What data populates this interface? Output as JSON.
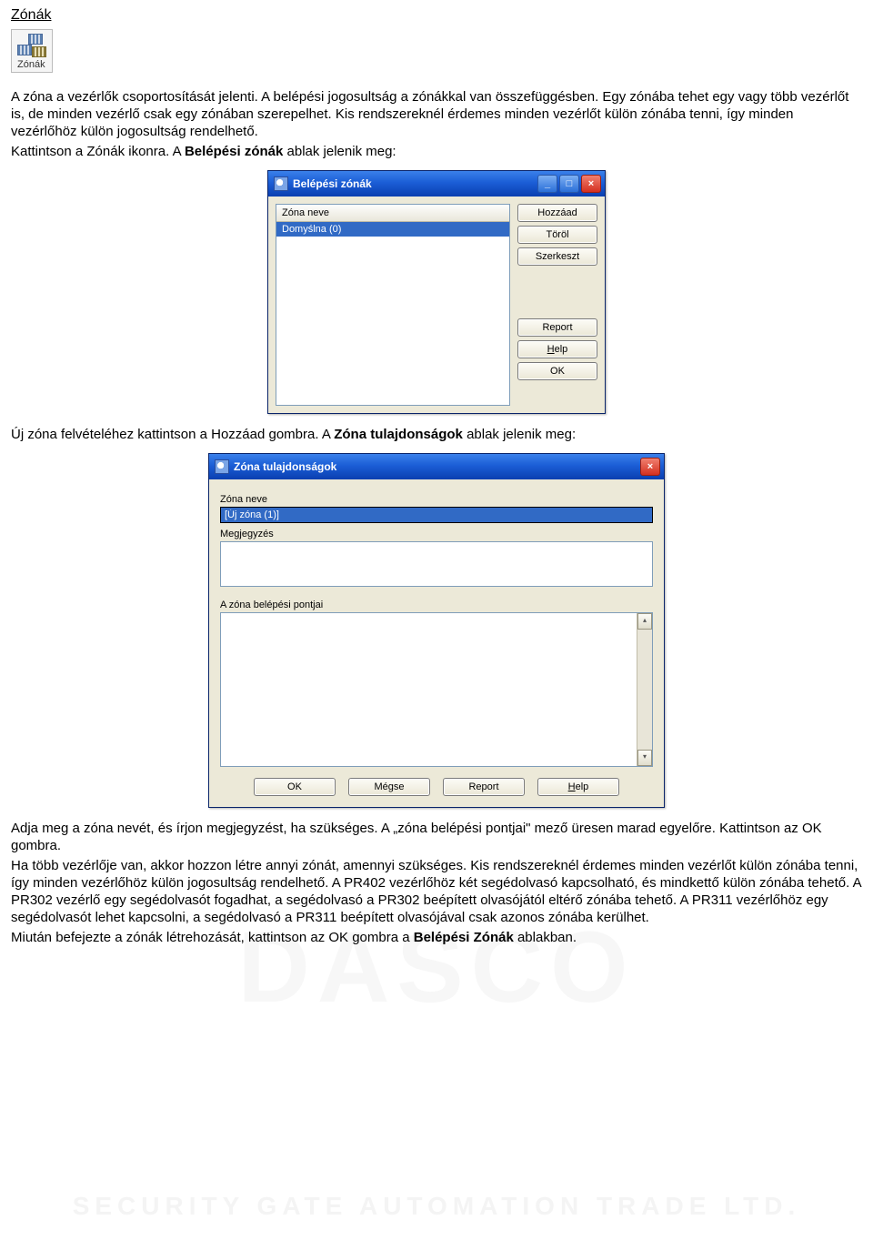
{
  "heading": "Zónák",
  "toolbar_icon_label": "Zónák",
  "intro": {
    "p1": "A zóna a vezérlők csoportosítását jelenti. A belépési jogosultság a zónákkal van összefüggésben. Egy zónába tehet egy vagy több vezérlőt is, de minden vezérlő csak egy zónában szerepelhet. Kis rendszereknél érdemes minden vezérlőt külön zónába tenni, így minden vezérlőhöz külön jogosultság rendelhető.",
    "p2_pre": "Kattintson a Zónák ikonra. A ",
    "p2_bold": "Belépési zónák",
    "p2_post": " ablak jelenik meg:"
  },
  "zones_window": {
    "title": "Belépési zónák",
    "list_header": "Zóna neve",
    "list_item": "Domyślna (0)",
    "btn_add": "Hozzáad",
    "btn_del": "Töröl",
    "btn_edit": "Szerkeszt",
    "btn_report": "Report",
    "btn_help_u": "H",
    "btn_help_rest": "elp",
    "btn_ok": "OK"
  },
  "mid": {
    "p1_pre": "Új zóna felvételéhez kattintson a Hozzáad gombra. A ",
    "p1_bold": "Zóna tulajdonságok",
    "p1_post": " ablak jelenik meg:"
  },
  "props_window": {
    "title": "Zóna tulajdonságok",
    "lbl_name": "Zóna neve",
    "val_name": "[Új zóna (1)]",
    "lbl_memo": "Megjegyzés",
    "lbl_points": "A zóna belépési pontjai",
    "btn_ok": "OK",
    "btn_cancel": "Mégse",
    "btn_report": "Report",
    "btn_help_u": "H",
    "btn_help_rest": "elp"
  },
  "outro": {
    "p1": "Adja meg a zóna nevét, és írjon megjegyzést, ha szükséges. A „zóna belépési pontjai\" mező üresen marad egyelőre. Kattintson az OK gombra.",
    "p2": "Ha több vezérlője van, akkor hozzon létre annyi zónát, amennyi szükséges. Kis rendszereknél érdemes minden vezérlőt külön zónába tenni, így minden vezérlőhöz külön jogosultság rendelhető. A PR402 vezérlőhöz két segédolvasó kapcsolható, és mindkettő külön zónába tehető. A PR302 vezérlő egy segédolvasót fogadhat, a segédolvasó a PR302 beépített olvasójától eltérő zónába tehető. A PR311 vezérlőhöz egy segédolvasót lehet kapcsolni, a segédolvasó a PR311 beépített olvasójával csak azonos zónába kerülhet.",
    "p3_pre": "Miután befejezte a zónák létrehozását, kattintson az OK gombra a ",
    "p3_bold": "Belépési Zónák",
    "p3_post": " ablakban."
  },
  "watermark_main": "DASCO",
  "watermark_sub": "SECURITY GATE AUTOMATION TRADE LTD."
}
